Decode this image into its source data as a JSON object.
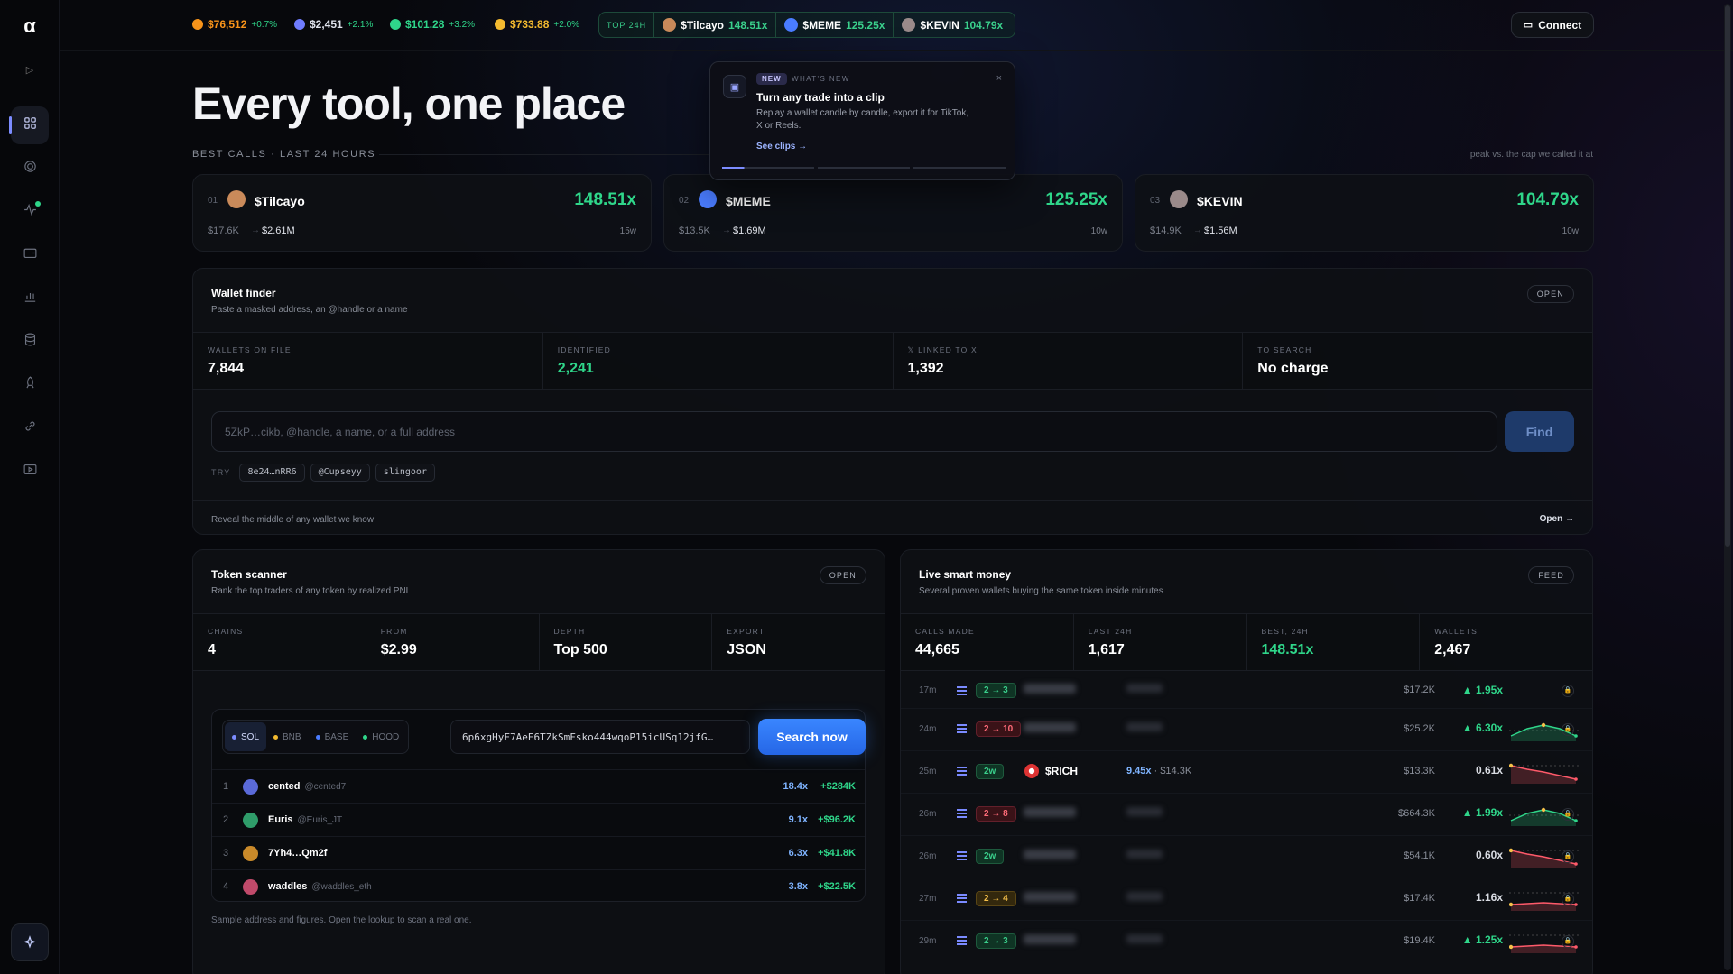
{
  "logo": "α",
  "sidebar": {
    "expand_icon": "chevron-right-icon",
    "items": [
      {
        "name": "sidebar-item-dashboard",
        "icon": "grid-icon",
        "active": true
      },
      {
        "name": "sidebar-item-target",
        "icon": "target-icon",
        "active": false
      },
      {
        "name": "sidebar-item-activity",
        "icon": "activity-icon",
        "active": false,
        "notify": true
      },
      {
        "name": "sidebar-item-wallet",
        "icon": "wallet-icon",
        "active": false
      },
      {
        "name": "sidebar-item-charts",
        "icon": "bar-chart-icon",
        "active": false
      },
      {
        "name": "sidebar-item-database",
        "icon": "database-icon",
        "active": false
      },
      {
        "name": "sidebar-item-rocket",
        "icon": "rocket-icon",
        "active": false
      },
      {
        "name": "sidebar-item-link",
        "icon": "link-icon",
        "active": false
      },
      {
        "name": "sidebar-item-clips",
        "icon": "video-icon",
        "active": false
      }
    ],
    "bottom_icon": "sparkle-icon"
  },
  "tickers": [
    {
      "icon": "btc-icon",
      "color": "#f7931a",
      "price": "$76,512",
      "change": "+0.7%",
      "price_color": "#f7931a"
    },
    {
      "icon": "eth-icon",
      "color": "#6f7cff",
      "price": "$2,451",
      "change": "+2.1%",
      "price_color": "#dfe3ec"
    },
    {
      "icon": "sol-icon",
      "color": "#2fd68a",
      "price": "$101.28",
      "change": "+3.2%",
      "price_color": "#2fd68a"
    },
    {
      "icon": "bnb-icon",
      "color": "#f3ba2f",
      "price": "$733.88",
      "change": "+2.0%",
      "price_color": "#f3ba2f"
    }
  ],
  "top24": {
    "label": "TOP 24H",
    "items": [
      {
        "name": "$Tilcayo",
        "mult": "148.51x",
        "color": "#c98a5a"
      },
      {
        "name": "$MEME",
        "mult": "125.25x",
        "color": "#4a7cff"
      },
      {
        "name": "$KEVIN",
        "mult": "104.79x",
        "color": "#9a8a8a"
      }
    ]
  },
  "connect_label": "Connect",
  "page_title": "Every tool, one place",
  "best_calls_label": "BEST CALLS · LAST 24 HOURS",
  "peak_note": "peak vs. the cap we called it at",
  "popup": {
    "badge": "NEW",
    "kicker": "WHAT'S NEW",
    "close": "×",
    "title": "Turn any trade into a clip",
    "body": "Replay a wallet candle by candle, export it for TikTok, X or Reels.",
    "link": "See clips →",
    "progress": 0.24
  },
  "calls": [
    {
      "rank": "01",
      "name": "$Tilcayo",
      "mult": "148.51x",
      "from": "$17.6K",
      "to": "$2.61M",
      "age": "15w",
      "color": "#c98a5a"
    },
    {
      "rank": "02",
      "name": "$MEME",
      "mult": "125.25x",
      "from": "$13.5K",
      "to": "$1.69M",
      "age": "10w",
      "color": "#4a7cff"
    },
    {
      "rank": "03",
      "name": "$KEVIN",
      "mult": "104.79x",
      "from": "$14.9K",
      "to": "$1.56M",
      "age": "10w",
      "color": "#9a8a8a"
    }
  ],
  "arrow": "→",
  "wallet_finder": {
    "title": "Wallet finder",
    "subtitle": "Paste a masked address, an @handle or a name",
    "pill": "OPEN",
    "stats": [
      {
        "label": "WALLETS ON FILE",
        "value": "7,844",
        "green": false
      },
      {
        "label": "IDENTIFIED",
        "value": "2,241",
        "green": true
      },
      {
        "label": "𝕏 LINKED TO X",
        "value": "1,392",
        "green": false
      },
      {
        "label": "TO SEARCH",
        "value": "No charge",
        "green": false
      }
    ],
    "placeholder": "5ZkP…cikb, @handle, a name, or a full address",
    "find_label": "Find",
    "try_label": "TRY",
    "chips": [
      "8e24…nRR6",
      "@Cupseyy",
      "slingoor"
    ],
    "footer_text": "Reveal the middle of any wallet we know",
    "footer_link": "Open →"
  },
  "token_scanner": {
    "title": "Token scanner",
    "subtitle": "Rank the top traders of any token by realized PNL",
    "pill": "OPEN",
    "stats": [
      {
        "label": "CHAINS",
        "value": "4"
      },
      {
        "label": "FROM",
        "value": "$2.99"
      },
      {
        "label": "DEPTH",
        "value": "Top 500"
      },
      {
        "label": "EXPORT",
        "value": "JSON"
      }
    ],
    "chains": [
      {
        "label": "SOL",
        "color": "#7c8cff",
        "on": true
      },
      {
        "label": "BNB",
        "color": "#f3ba2f",
        "on": false
      },
      {
        "label": "BASE",
        "color": "#4a7cff",
        "on": false
      },
      {
        "label": "HOOD",
        "color": "#2fd68a",
        "on": false
      }
    ],
    "address": "6p6xgHyF7AeE6TZkSmFsko444wqoP15icUSq12jfG…",
    "search_label": "Search now",
    "rows": [
      {
        "rank": "1",
        "name": "cented",
        "handle": "@cented7",
        "mult": "18.4x",
        "pnl": "+$284K",
        "color": "#5a6ad8"
      },
      {
        "rank": "2",
        "name": "Euris",
        "handle": "@Euris_JT",
        "mult": "9.1x",
        "pnl": "+$96.2K",
        "color": "#2f9d6a"
      },
      {
        "rank": "3",
        "name": "7Yh4…Qm2f",
        "handle": "",
        "mult": "6.3x",
        "pnl": "+$41.8K",
        "color": "#c98a2a"
      },
      {
        "rank": "4",
        "name": "waddles",
        "handle": "@waddles_eth",
        "mult": "3.8x",
        "pnl": "+$22.5K",
        "color": "#c04a6a"
      }
    ],
    "note": "Sample address and figures. Open the lookup to scan a real one."
  },
  "live": {
    "title": "Live smart money",
    "subtitle": "Several proven wallets buying the same token inside minutes",
    "pill": "FEED",
    "stats": [
      {
        "label": "CALLS MADE",
        "value": "44,665",
        "green": false
      },
      {
        "label": "LAST 24H",
        "value": "1,617",
        "green": false
      },
      {
        "label": "BEST, 24H",
        "value": "148.51x",
        "green": true
      },
      {
        "label": "WALLETS",
        "value": "2,467",
        "green": false
      }
    ],
    "rows": [
      {
        "time": "17m",
        "badge": "2 → 3",
        "kind": "g",
        "cap": "$17.2K",
        "mult": "▲ 1.95x",
        "up": true,
        "spark": "none",
        "lock": true
      },
      {
        "time": "24m",
        "badge": "2 → 10",
        "kind": "r",
        "cap": "$25.2K",
        "mult": "▲ 6.30x",
        "up": true,
        "spark": "up",
        "lock": true
      },
      {
        "time": "25m",
        "badge": "2w",
        "kind": "g",
        "token": "$RICH",
        "inline_mult": "9.45x",
        "inline_cap": "· $14.3K",
        "cap": "$13.3K",
        "mult": "0.61x",
        "up": false,
        "spark": "down",
        "lock": false
      },
      {
        "time": "26m",
        "badge": "2 → 8",
        "kind": "r",
        "cap": "$664.3K",
        "mult": "▲ 1.99x",
        "up": true,
        "spark": "up",
        "lock": true
      },
      {
        "time": "26m",
        "badge": "2w",
        "kind": "g",
        "cap": "$54.1K",
        "mult": "0.60x",
        "up": false,
        "spark": "down",
        "lock": true
      },
      {
        "time": "27m",
        "badge": "2 → 4",
        "kind": "y",
        "cap": "$17.4K",
        "mult": "1.16x",
        "up": false,
        "spark": "flat",
        "lock": true
      },
      {
        "time": "29m",
        "badge": "2 → 3",
        "kind": "g",
        "cap": "$19.4K",
        "mult": "▲ 1.25x",
        "up": true,
        "spark": "flat",
        "lock": true
      }
    ]
  }
}
